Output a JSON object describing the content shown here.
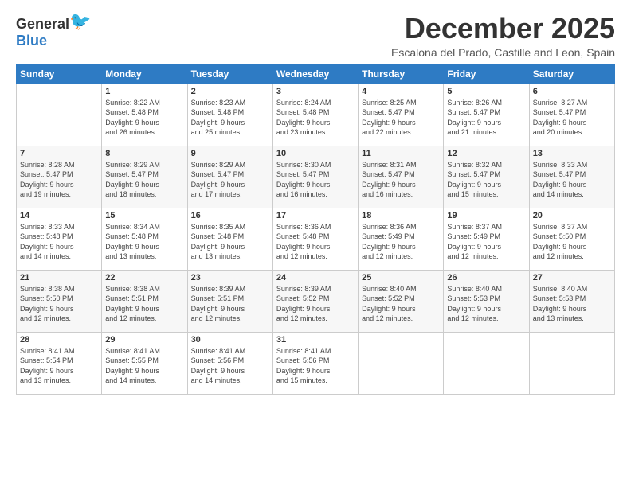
{
  "logo": {
    "general": "General",
    "blue": "Blue"
  },
  "title": "December 2025",
  "subtitle": "Escalona del Prado, Castille and Leon, Spain",
  "header_days": [
    "Sunday",
    "Monday",
    "Tuesday",
    "Wednesday",
    "Thursday",
    "Friday",
    "Saturday"
  ],
  "weeks": [
    [
      {
        "day": "",
        "info": ""
      },
      {
        "day": "1",
        "info": "Sunrise: 8:22 AM\nSunset: 5:48 PM\nDaylight: 9 hours\nand 26 minutes."
      },
      {
        "day": "2",
        "info": "Sunrise: 8:23 AM\nSunset: 5:48 PM\nDaylight: 9 hours\nand 25 minutes."
      },
      {
        "day": "3",
        "info": "Sunrise: 8:24 AM\nSunset: 5:48 PM\nDaylight: 9 hours\nand 23 minutes."
      },
      {
        "day": "4",
        "info": "Sunrise: 8:25 AM\nSunset: 5:47 PM\nDaylight: 9 hours\nand 22 minutes."
      },
      {
        "day": "5",
        "info": "Sunrise: 8:26 AM\nSunset: 5:47 PM\nDaylight: 9 hours\nand 21 minutes."
      },
      {
        "day": "6",
        "info": "Sunrise: 8:27 AM\nSunset: 5:47 PM\nDaylight: 9 hours\nand 20 minutes."
      }
    ],
    [
      {
        "day": "7",
        "info": "Sunrise: 8:28 AM\nSunset: 5:47 PM\nDaylight: 9 hours\nand 19 minutes."
      },
      {
        "day": "8",
        "info": "Sunrise: 8:29 AM\nSunset: 5:47 PM\nDaylight: 9 hours\nand 18 minutes."
      },
      {
        "day": "9",
        "info": "Sunrise: 8:29 AM\nSunset: 5:47 PM\nDaylight: 9 hours\nand 17 minutes."
      },
      {
        "day": "10",
        "info": "Sunrise: 8:30 AM\nSunset: 5:47 PM\nDaylight: 9 hours\nand 16 minutes."
      },
      {
        "day": "11",
        "info": "Sunrise: 8:31 AM\nSunset: 5:47 PM\nDaylight: 9 hours\nand 16 minutes."
      },
      {
        "day": "12",
        "info": "Sunrise: 8:32 AM\nSunset: 5:47 PM\nDaylight: 9 hours\nand 15 minutes."
      },
      {
        "day": "13",
        "info": "Sunrise: 8:33 AM\nSunset: 5:47 PM\nDaylight: 9 hours\nand 14 minutes."
      }
    ],
    [
      {
        "day": "14",
        "info": "Sunrise: 8:33 AM\nSunset: 5:48 PM\nDaylight: 9 hours\nand 14 minutes."
      },
      {
        "day": "15",
        "info": "Sunrise: 8:34 AM\nSunset: 5:48 PM\nDaylight: 9 hours\nand 13 minutes."
      },
      {
        "day": "16",
        "info": "Sunrise: 8:35 AM\nSunset: 5:48 PM\nDaylight: 9 hours\nand 13 minutes."
      },
      {
        "day": "17",
        "info": "Sunrise: 8:36 AM\nSunset: 5:48 PM\nDaylight: 9 hours\nand 12 minutes."
      },
      {
        "day": "18",
        "info": "Sunrise: 8:36 AM\nSunset: 5:49 PM\nDaylight: 9 hours\nand 12 minutes."
      },
      {
        "day": "19",
        "info": "Sunrise: 8:37 AM\nSunset: 5:49 PM\nDaylight: 9 hours\nand 12 minutes."
      },
      {
        "day": "20",
        "info": "Sunrise: 8:37 AM\nSunset: 5:50 PM\nDaylight: 9 hours\nand 12 minutes."
      }
    ],
    [
      {
        "day": "21",
        "info": "Sunrise: 8:38 AM\nSunset: 5:50 PM\nDaylight: 9 hours\nand 12 minutes."
      },
      {
        "day": "22",
        "info": "Sunrise: 8:38 AM\nSunset: 5:51 PM\nDaylight: 9 hours\nand 12 minutes."
      },
      {
        "day": "23",
        "info": "Sunrise: 8:39 AM\nSunset: 5:51 PM\nDaylight: 9 hours\nand 12 minutes."
      },
      {
        "day": "24",
        "info": "Sunrise: 8:39 AM\nSunset: 5:52 PM\nDaylight: 9 hours\nand 12 minutes."
      },
      {
        "day": "25",
        "info": "Sunrise: 8:40 AM\nSunset: 5:52 PM\nDaylight: 9 hours\nand 12 minutes."
      },
      {
        "day": "26",
        "info": "Sunrise: 8:40 AM\nSunset: 5:53 PM\nDaylight: 9 hours\nand 12 minutes."
      },
      {
        "day": "27",
        "info": "Sunrise: 8:40 AM\nSunset: 5:53 PM\nDaylight: 9 hours\nand 13 minutes."
      }
    ],
    [
      {
        "day": "28",
        "info": "Sunrise: 8:41 AM\nSunset: 5:54 PM\nDaylight: 9 hours\nand 13 minutes."
      },
      {
        "day": "29",
        "info": "Sunrise: 8:41 AM\nSunset: 5:55 PM\nDaylight: 9 hours\nand 14 minutes."
      },
      {
        "day": "30",
        "info": "Sunrise: 8:41 AM\nSunset: 5:56 PM\nDaylight: 9 hours\nand 14 minutes."
      },
      {
        "day": "31",
        "info": "Sunrise: 8:41 AM\nSunset: 5:56 PM\nDaylight: 9 hours\nand 15 minutes."
      },
      {
        "day": "",
        "info": ""
      },
      {
        "day": "",
        "info": ""
      },
      {
        "day": "",
        "info": ""
      }
    ]
  ]
}
